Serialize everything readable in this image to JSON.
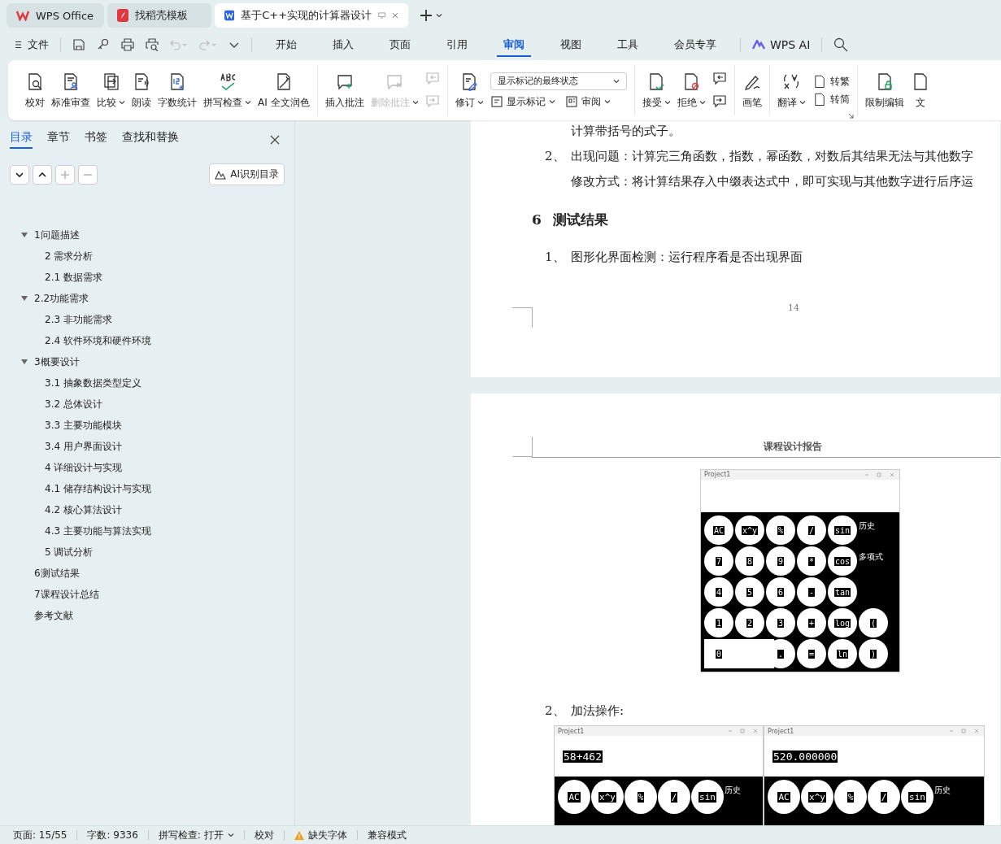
{
  "tabs": [
    {
      "label": "WPS Office",
      "selected": false
    },
    {
      "label": "找稻壳模板",
      "selected": false
    },
    {
      "label": "基于C++实现的计算器设计",
      "selected": true
    }
  ],
  "menu": {
    "file": "文件",
    "items": [
      {
        "label": "开始",
        "selected": false
      },
      {
        "label": "插入",
        "selected": false
      },
      {
        "label": "页面",
        "selected": false
      },
      {
        "label": "引用",
        "selected": false
      },
      {
        "label": "审阅",
        "selected": true
      },
      {
        "label": "视图",
        "selected": false
      },
      {
        "label": "工具",
        "selected": false
      },
      {
        "label": "会员专享",
        "selected": false
      }
    ],
    "ai": "WPS AI"
  },
  "ribbon": {
    "groups": [
      {
        "items": [
          {
            "kind": "large",
            "label": "校对",
            "menu": false,
            "disabled": false
          },
          {
            "kind": "large",
            "label": "标准审查",
            "menu": false,
            "disabled": false
          },
          {
            "kind": "large",
            "label": "比较",
            "menu": true,
            "disabled": false
          },
          {
            "kind": "large",
            "label": "朗读",
            "menu": false,
            "disabled": false
          },
          {
            "kind": "large",
            "label": "字数统计",
            "menu": false,
            "disabled": false
          },
          {
            "kind": "large",
            "label": "拼写检查",
            "menu": true,
            "disabled": false
          },
          {
            "kind": "large",
            "label": "AI 全文润色",
            "menu": false,
            "disabled": false
          }
        ]
      },
      {
        "items": [
          {
            "kind": "large",
            "label": "插入批注",
            "menu": false,
            "disabled": false
          },
          {
            "kind": "large",
            "label": "删除批注",
            "menu": true,
            "disabled": true
          },
          {
            "kind": "stack",
            "buttons": [
              {
                "disabled": true
              },
              {
                "disabled": true
              }
            ]
          }
        ]
      },
      {
        "items": [
          {
            "kind": "large",
            "label": "修订",
            "menu": true,
            "disabled": false
          },
          {
            "kind": "select",
            "value": "显示标记的最终状态",
            "buttons": [
              {
                "label": "显示标记",
                "menu": true
              },
              {
                "label": "审阅",
                "menu": true
              }
            ]
          }
        ]
      },
      {
        "items": [
          {
            "kind": "large",
            "label": "接受",
            "menu": true,
            "disabled": false
          },
          {
            "kind": "large",
            "label": "拒绝",
            "menu": true,
            "disabled": false
          },
          {
            "kind": "stack",
            "buttons": [
              {
                "disabled": false
              },
              {
                "disabled": false
              }
            ]
          }
        ]
      },
      {
        "items": [
          {
            "kind": "large",
            "label": "画笔",
            "menu": false,
            "disabled": false
          }
        ]
      },
      {
        "items": [
          {
            "kind": "large",
            "label": "翻译",
            "menu": true,
            "disabled": false
          },
          {
            "kind": "labels",
            "buttons": [
              {
                "label": "转繁"
              },
              {
                "label": "转简"
              }
            ]
          }
        ]
      },
      {
        "items": [
          {
            "kind": "large",
            "label": "限制编辑",
            "menu": false,
            "disabled": false
          },
          {
            "kind": "large",
            "label": "文",
            "menu": false,
            "disabled": false
          }
        ]
      }
    ]
  },
  "sidebar": {
    "tabs": [
      {
        "label": "目录",
        "selected": true
      },
      {
        "label": "章节",
        "selected": false
      },
      {
        "label": "书签",
        "selected": false
      },
      {
        "label": "查找和替换",
        "selected": false
      }
    ],
    "controls": [
      {
        "disabled": false
      },
      {
        "disabled": false
      },
      {
        "disabled": true
      },
      {
        "disabled": true
      }
    ],
    "ai_button": "AI识别目录",
    "outline": [
      {
        "label": "1问题描述",
        "expanded": true,
        "children": [
          {
            "label": "2 需求分析"
          },
          {
            "label": "2.1 数据需求"
          }
        ]
      },
      {
        "label": "2.2功能需求",
        "expanded": true,
        "children": [
          {
            "label": "2.3 非功能需求"
          },
          {
            "label": "2.4 软件环境和硬件环境"
          }
        ]
      },
      {
        "label": "3概要设计",
        "expanded": true,
        "children": [
          {
            "label": "3.1 抽象数据类型定义"
          },
          {
            "label": "3.2 总体设计"
          },
          {
            "label": "3.3  主要功能模块"
          },
          {
            "label": "3.4  用户界面设计"
          },
          {
            "label": "4 详细设计与实现"
          },
          {
            "label": "4.1  储存结构设计与实现"
          },
          {
            "label": "4.2 核心算法设计"
          },
          {
            "label": "4.3  主要功能与算法实现"
          },
          {
            "label": "5 调试分析"
          }
        ]
      },
      {
        "label": "6测试结果"
      },
      {
        "label": "7课程设计总结"
      },
      {
        "label": "参考文献"
      }
    ]
  },
  "document": {
    "page_1": {
      "lines": [
        {
          "kind": "continuation",
          "text": "计算带括号的式子。"
        },
        {
          "kind": "item",
          "number": "2、",
          "text": "出现问题：计算完三角函数，指数，幂函数，对数后其结果无法与其他数字"
        },
        {
          "kind": "continuation",
          "text": "修改方式：将计算结果存入中缀表达式中，即可实现与其他数字进行后序运"
        },
        {
          "kind": "heading",
          "number": "6",
          "text": "测试结果"
        },
        {
          "kind": "item",
          "number": "1、",
          "text": "图形化界面检测：运行程序看是否出现界面"
        }
      ],
      "page_number": "14"
    },
    "page_2": {
      "header": "课程设计报告",
      "screenshot": {
        "title": "Project1",
        "rows": [
          [
            {
              "kind": "round",
              "label": "AC"
            },
            {
              "kind": "round",
              "label": "x^y"
            },
            {
              "kind": "round",
              "label": "%"
            },
            {
              "kind": "round",
              "label": "/"
            },
            {
              "kind": "round",
              "label": "sin"
            },
            {
              "kind": "text",
              "label": "历史"
            }
          ],
          [
            {
              "kind": "round",
              "label": "7"
            },
            {
              "kind": "round",
              "label": "8"
            },
            {
              "kind": "round",
              "label": "9"
            },
            {
              "kind": "round",
              "label": "*"
            },
            {
              "kind": "round",
              "label": "cos"
            },
            {
              "kind": "text",
              "label": "多项式"
            }
          ],
          [
            {
              "kind": "round",
              "label": "4"
            },
            {
              "kind": "round",
              "label": "5"
            },
            {
              "kind": "round",
              "label": "6"
            },
            {
              "kind": "round",
              "label": "-"
            },
            {
              "kind": "round",
              "label": "tan"
            }
          ],
          [
            {
              "kind": "round",
              "label": "1"
            },
            {
              "kind": "round",
              "label": "2"
            },
            {
              "kind": "round",
              "label": "3"
            },
            {
              "kind": "round",
              "label": "+"
            },
            {
              "kind": "round",
              "label": "log"
            },
            {
              "kind": "round",
              "label": "("
            }
          ],
          [
            {
              "kind": "wide",
              "label": "0"
            },
            {
              "kind": "blank"
            },
            {
              "kind": "round",
              "label": "."
            },
            {
              "kind": "round",
              "label": "="
            },
            {
              "kind": "round",
              "label": "ln"
            },
            {
              "kind": "round",
              "label": ")"
            }
          ]
        ]
      },
      "item": {
        "number": "2、",
        "text": "加法操作:"
      },
      "screenshots": [
        {
          "title": "Project1",
          "display": "58+462",
          "rows": [
            [
              {
                "kind": "round",
                "label": "AC"
              },
              {
                "kind": "round",
                "label": "x^y"
              },
              {
                "kind": "round",
                "label": "%"
              },
              {
                "kind": "round",
                "label": "/"
              },
              {
                "kind": "round",
                "label": "sin"
              },
              {
                "kind": "text",
                "label": "历史"
              }
            ]
          ]
        },
        {
          "title": "Project1",
          "display": "520.000000",
          "rows": [
            [
              {
                "kind": "round",
                "label": "AC"
              },
              {
                "kind": "round",
                "label": "x^y"
              },
              {
                "kind": "round",
                "label": "%"
              },
              {
                "kind": "round",
                "label": "/"
              },
              {
                "kind": "round",
                "label": "sin"
              },
              {
                "kind": "text",
                "label": "历史"
              }
            ]
          ]
        }
      ]
    }
  },
  "status_bar": [
    {
      "kind": "text",
      "label": "页面: 15/55"
    },
    {
      "kind": "text",
      "label": "字数: 9336"
    },
    {
      "kind": "menu",
      "label": "拼写检查: 打开"
    },
    {
      "kind": "text",
      "label": "校对"
    },
    {
      "kind": "warning",
      "label": "缺失字体"
    },
    {
      "kind": "text",
      "label": "兼容模式"
    }
  ]
}
